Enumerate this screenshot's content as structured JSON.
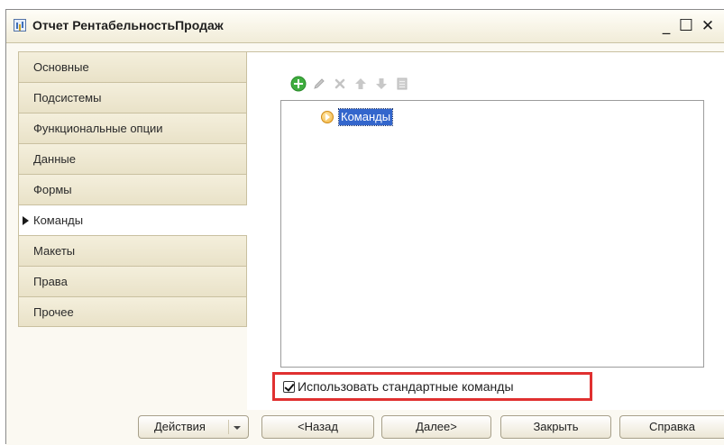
{
  "window": {
    "title": "Отчет РентабельностьПродаж",
    "controls": {
      "minimize": "_",
      "maximize": "☐",
      "close": "✕"
    }
  },
  "tabs": [
    {
      "label": "Основные",
      "active": false
    },
    {
      "label": "Подсистемы",
      "active": false
    },
    {
      "label": "Функциональные опции",
      "active": false
    },
    {
      "label": "Данные",
      "active": false
    },
    {
      "label": "Формы",
      "active": false
    },
    {
      "label": "Команды",
      "active": true
    },
    {
      "label": "Макеты",
      "active": false
    },
    {
      "label": "Права",
      "active": false
    },
    {
      "label": "Прочее",
      "active": false
    }
  ],
  "toolbar": {
    "icons": [
      "add-icon",
      "edit-icon",
      "delete-icon",
      "move-up-icon",
      "move-down-icon",
      "list-icon"
    ]
  },
  "tree": {
    "root_label": "Команды",
    "root_icon": "commands-folder-icon"
  },
  "options": {
    "use_standard_commands_label": "Использовать стандартные команды",
    "use_standard_commands_checked": true
  },
  "buttons": {
    "actions": "Действия",
    "back": "<Назад",
    "next": "Далее>",
    "close": "Закрыть",
    "help": "Справка"
  },
  "colors": {
    "selection": "#3366cc",
    "highlight_border": "#e03030",
    "add_icon": "#3fae3f",
    "tab_background": "#ece5cb"
  }
}
